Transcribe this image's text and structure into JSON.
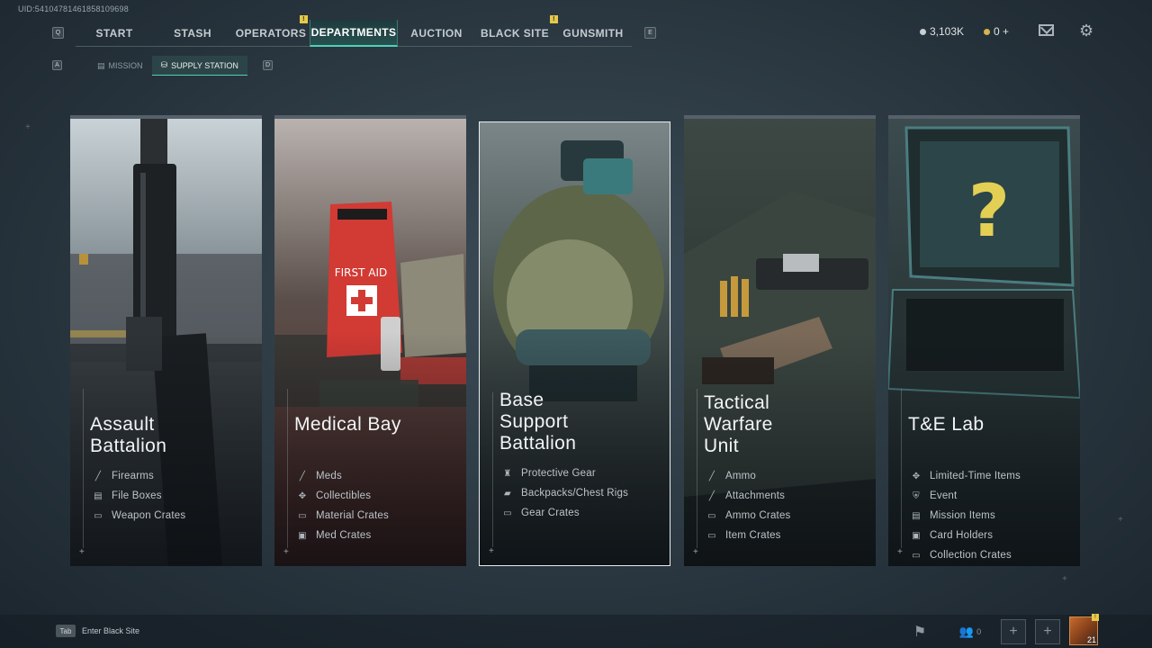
{
  "uid": "UID:5410478146185810969​8",
  "nav": {
    "left_key": "Q",
    "right_key": "E",
    "tabs": [
      {
        "label": "START",
        "alert": false
      },
      {
        "label": "STASH",
        "alert": false
      },
      {
        "label": "OPERATORS",
        "alert": true
      },
      {
        "label": "DEPARTMENTS",
        "alert": false,
        "active": true
      },
      {
        "label": "AUCTION",
        "alert": false
      },
      {
        "label": "BLACK SITE",
        "alert": true
      },
      {
        "label": "GUNSMITH",
        "alert": false
      }
    ],
    "alert_glyph": "!"
  },
  "subnav": {
    "left_key": "A",
    "right_key": "D",
    "tabs": [
      {
        "label": "MISSION"
      },
      {
        "label": "SUPPLY STATION",
        "active": true
      }
    ]
  },
  "currency": {
    "silver": "3,103K",
    "gold": "0 +"
  },
  "cards": [
    {
      "name": "Assault\nBattalion",
      "items": [
        {
          "label": "Firearms",
          "icon": "rifle-icon"
        },
        {
          "label": "File Boxes",
          "icon": "box-icon"
        },
        {
          "label": "Weapon Crates",
          "icon": "crate-icon"
        }
      ]
    },
    {
      "name": "Medical Bay",
      "items": [
        {
          "label": "Meds",
          "icon": "syringe-icon"
        },
        {
          "label": "Collectibles",
          "icon": "collectible-icon"
        },
        {
          "label": "Material Crates",
          "icon": "crate-icon"
        },
        {
          "label": "Med Crates",
          "icon": "med-crate-icon"
        }
      ]
    },
    {
      "name": "Base\nSupport\nBattalion",
      "selected": true,
      "items": [
        {
          "label": "Protective Gear",
          "icon": "vest-icon"
        },
        {
          "label": "Backpacks/Chest Rigs",
          "icon": "backpack-icon"
        },
        {
          "label": "Gear Crates",
          "icon": "crate-icon"
        }
      ]
    },
    {
      "name": "Tactical\nWarfare\nUnit",
      "items": [
        {
          "label": "Ammo",
          "icon": "bullet-icon"
        },
        {
          "label": "Attachments",
          "icon": "attachment-icon"
        },
        {
          "label": "Ammo Crates",
          "icon": "crate-icon"
        },
        {
          "label": "Item Crates",
          "icon": "crate-icon"
        }
      ]
    },
    {
      "name": "T&E Lab",
      "items": [
        {
          "label": "Limited-Time Items",
          "icon": "collectible-icon"
        },
        {
          "label": "Event",
          "icon": "event-icon"
        },
        {
          "label": "Mission Items",
          "icon": "mission-icon"
        },
        {
          "label": "Card Holders",
          "icon": "card-icon"
        },
        {
          "label": "Collection Crates",
          "icon": "crate-icon"
        }
      ]
    }
  ],
  "bottom": {
    "tab_key": "Tab",
    "enter_label": "Enter Black Site",
    "squad_count": "0",
    "avatar_level": "21"
  },
  "colors": {
    "accent": "#4fd1b8",
    "alert": "#e6c84a",
    "medical_red": "#d23a34"
  }
}
